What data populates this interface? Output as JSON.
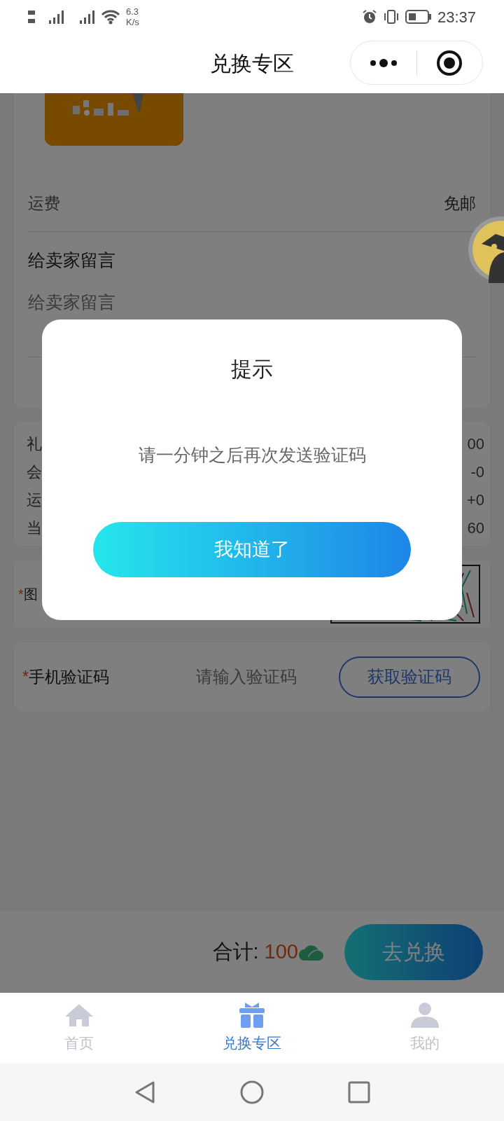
{
  "status_bar": {
    "network_speed_value": "6.3",
    "network_speed_unit": "K/s",
    "time": "23:37"
  },
  "header": {
    "title": "兑换专区"
  },
  "order": {
    "shipping": {
      "label": "运费",
      "value": "免邮"
    },
    "message": {
      "label": "给卖家留言",
      "placeholder": "给卖家留言"
    }
  },
  "summary_rows": [
    {
      "label": "礼",
      "value": "00"
    },
    {
      "label": "会",
      "value": "-0"
    },
    {
      "label": "运",
      "value": "+0"
    },
    {
      "label": "当",
      "value": "60"
    }
  ],
  "captcha_row": {
    "required_mark": "*",
    "label": "图"
  },
  "sms_row": {
    "required_mark": "*",
    "label": "手机验证码",
    "placeholder": "请输入验证码",
    "button": "获取验证码"
  },
  "checkout": {
    "total_label": "合计:",
    "total_value": "100",
    "button": "去兑换"
  },
  "dialog": {
    "title": "提示",
    "message": "请一分钟之后再次发送验证码",
    "button": "我知道了"
  },
  "tabs": [
    {
      "label": "首页",
      "kind": "home",
      "selected": false
    },
    {
      "label": "兑换专区",
      "kind": "gift",
      "selected": true
    },
    {
      "label": "我的",
      "kind": "person",
      "selected": false
    }
  ]
}
